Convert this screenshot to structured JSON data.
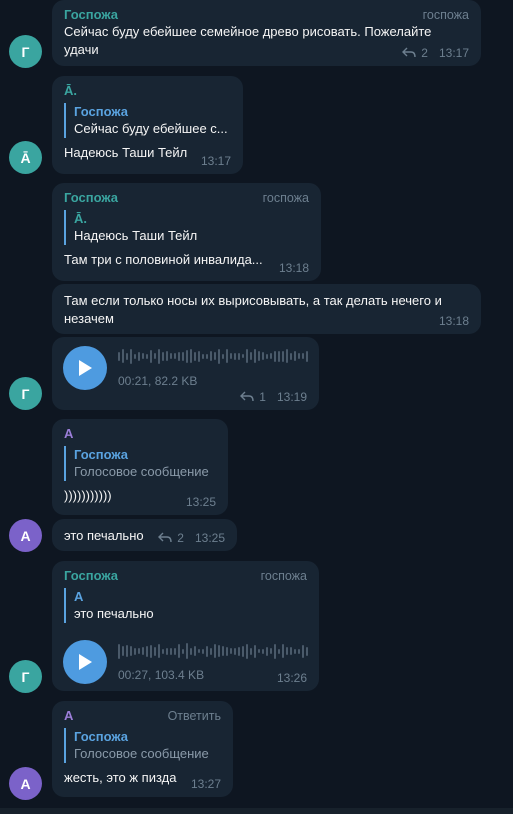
{
  "colors": {
    "bg": "#0e1621",
    "bubble": "#182533",
    "accent": "#4e9be0",
    "avatar_teal": "#3aa5a0",
    "avatar_purple": "#7b62c9"
  },
  "messages": [
    {
      "avatar": "Г",
      "sender": "Госпожа",
      "role": "госпожа",
      "text": "Сейчас буду ебейшее семейное древо рисовать. Пожелайте удачи",
      "replies": "2",
      "time": "13:17"
    },
    {
      "avatar": "Ā",
      "sender": "Ā.",
      "quote_name": "Госпожа",
      "quote_text": "Сейчас буду ебейшее с...",
      "text": "Надеюсь Таши Тейл",
      "time": "13:17"
    },
    {
      "sender": "Госпожа",
      "role": "госпожа",
      "quote_name": "Ā.",
      "quote_text": "Надеюсь Таши Тейл",
      "text": "Там три с половиной инвалида...",
      "time": "13:18"
    },
    {
      "text": "Там если только носы их вырисовывать, а так делать нечего и незачем",
      "time": "13:18"
    },
    {
      "avatar": "Г",
      "voice_info": "00:21, 82.2 KB",
      "replies": "1",
      "time": "13:19"
    },
    {
      "sender": "А",
      "quote_name": "Госпожа",
      "quote_text": "Голосовое сообщение",
      "text": ")))))))))))",
      "time": "13:25"
    },
    {
      "avatar": "А",
      "text": "это печально",
      "replies": "2",
      "time": "13:25"
    },
    {
      "avatar": "Г",
      "sender": "Госпожа",
      "role": "госпожа",
      "quote_name": "А",
      "quote_text": "это печально",
      "voice_info": "00:27, 103.4 KB",
      "time": "13:26"
    },
    {
      "avatar": "А",
      "sender": "А",
      "action": "Ответить",
      "quote_name": "Госпожа",
      "quote_text": "Голосовое сообщение",
      "text": "жесть, это ж пизда",
      "time": "13:27"
    }
  ]
}
